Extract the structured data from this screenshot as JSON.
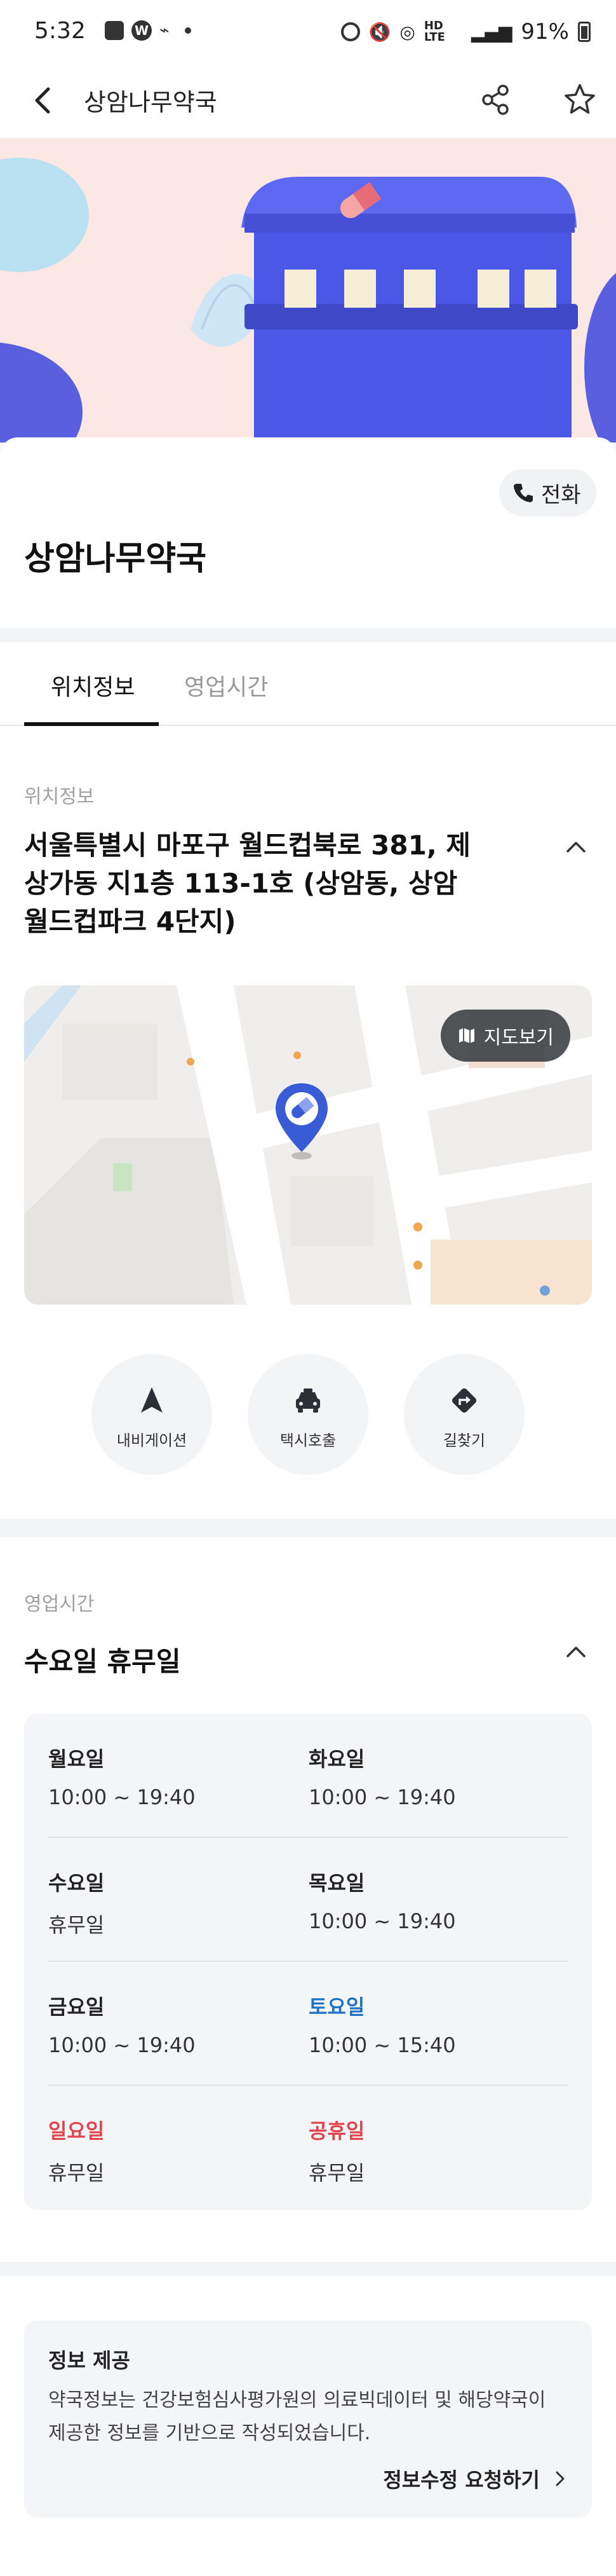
{
  "status_bar": {
    "time": "5:32",
    "battery": "91%",
    "network_label": "HD LTE"
  },
  "header": {
    "title": "상암나무약국"
  },
  "pharmacy": {
    "name": "상암나무약국",
    "call_label": "전화"
  },
  "tabs": [
    {
      "label": "위치정보",
      "active": true
    },
    {
      "label": "영업시간",
      "active": false
    }
  ],
  "location": {
    "section_label": "위치정보",
    "address": "서울특별시 마포구 월드컵북로 381, 제상가동 지1층 113-1호 (상암동, 상암 월드컵파크 4단지)",
    "map_button": "지도보기",
    "actions": [
      {
        "label": "내비게이션",
        "icon": "navigation-arrow-icon"
      },
      {
        "label": "택시호출",
        "icon": "taxi-icon"
      },
      {
        "label": "길찾기",
        "icon": "directions-icon"
      }
    ]
  },
  "hours": {
    "section_label": "영업시간",
    "summary": "수요일 휴무일",
    "days": [
      {
        "day": "월요일",
        "time": "10:00 ~ 19:40",
        "color": "#222222"
      },
      {
        "day": "화요일",
        "time": "10:00 ~ 19:40",
        "color": "#222222"
      },
      {
        "day": "수요일",
        "time": "휴무일",
        "color": "#222222"
      },
      {
        "day": "목요일",
        "time": "10:00 ~ 19:40",
        "color": "#222222"
      },
      {
        "day": "금요일",
        "time": "10:00 ~ 19:40",
        "color": "#222222"
      },
      {
        "day": "토요일",
        "time": "10:00 ~ 15:40",
        "color": "#1a73c8"
      },
      {
        "day": "일요일",
        "time": "휴무일",
        "color": "#e0454d"
      },
      {
        "day": "공휴일",
        "time": "휴무일",
        "color": "#e0454d"
      }
    ]
  },
  "info_provision": {
    "title": "정보 제공",
    "text": "약국정보는 건강보험심사평가원의 의료빅데이터 및 해당약국이 제공한 정보를 기반으로 작성되었습니다.",
    "edit_link": "정보수정 요청하기"
  },
  "colors": {
    "accent_blue": "#1a73c8",
    "holiday_red": "#e0454d",
    "hero_bg": "#fbe7e4",
    "building": "#5865e8"
  }
}
